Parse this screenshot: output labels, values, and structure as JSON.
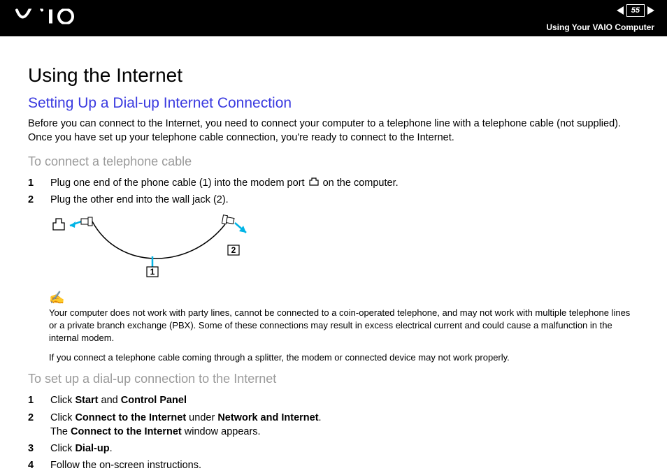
{
  "header": {
    "page_number": "55",
    "subtitle": "Using Your VAIO Computer"
  },
  "page": {
    "h1": "Using the Internet",
    "h2": "Setting Up a Dial-up Internet Connection",
    "intro": "Before you can connect to the Internet, you need to connect your computer to a telephone line with a telephone cable (not supplied). Once you have set up your telephone cable connection, you're ready to connect to the Internet.",
    "h3a": "To connect a telephone cable",
    "steps_a": {
      "s1_pre": "Plug one end of the phone cable (1) into the modem port ",
      "s1_post": " on the computer.",
      "s2": "Plug the other end into the wall jack (2)."
    },
    "note_icon": "✍",
    "note_p1": "Your computer does not work with party lines, cannot be connected to a coin-operated telephone, and may not work with multiple telephone lines or a private branch exchange (PBX). Some of these connections may result in excess electrical current and could cause a malfunction in the internal modem.",
    "note_p2": "If you connect a telephone cable coming through a splitter, the modem or connected device may not work properly.",
    "h3b": "To set up a dial-up connection to the Internet",
    "steps_b": {
      "s1_pre": "Click ",
      "s1_b1": "Start",
      "s1_mid": " and ",
      "s1_b2": "Control Panel",
      "s2_pre": "Click ",
      "s2_b1": "Connect to the Internet",
      "s2_mid": " under ",
      "s2_b2": "Network and Internet",
      "s2_end": ".",
      "s2_line2_pre": "The ",
      "s2_line2_b": "Connect to the Internet",
      "s2_line2_post": " window appears.",
      "s3_pre": "Click ",
      "s3_b": "Dial-up",
      "s3_end": ".",
      "s4": "Follow the on-screen instructions."
    },
    "diagram": {
      "label1": "1",
      "label2": "2"
    }
  }
}
